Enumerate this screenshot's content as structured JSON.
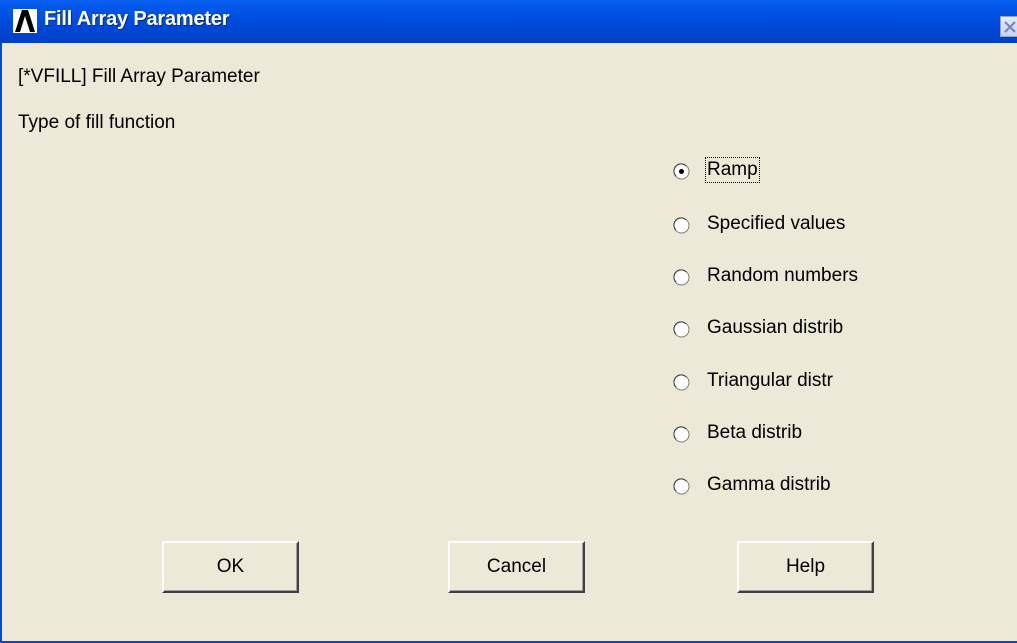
{
  "window": {
    "title": "Fill Array Parameter",
    "title_color": "#ffffff",
    "titlebar_color": "#0048d8",
    "background_color": "#ece9d8"
  },
  "icons": {
    "app": "ansys-logo-icon",
    "close": "close-icon"
  },
  "command_label": "[*VFILL]  Fill Array Parameter",
  "fill_type_label": "Type of fill function",
  "options": [
    {
      "label": "Ramp",
      "selected": true
    },
    {
      "label": "Specified values",
      "selected": false
    },
    {
      "label": "Random numbers",
      "selected": false
    },
    {
      "label": "Gaussian distrib",
      "selected": false
    },
    {
      "label": "Triangular distr",
      "selected": false
    },
    {
      "label": "Beta distrib",
      "selected": false
    },
    {
      "label": "Gamma distrib",
      "selected": false
    }
  ],
  "buttons": {
    "ok": "OK",
    "cancel": "Cancel",
    "help": "Help"
  }
}
